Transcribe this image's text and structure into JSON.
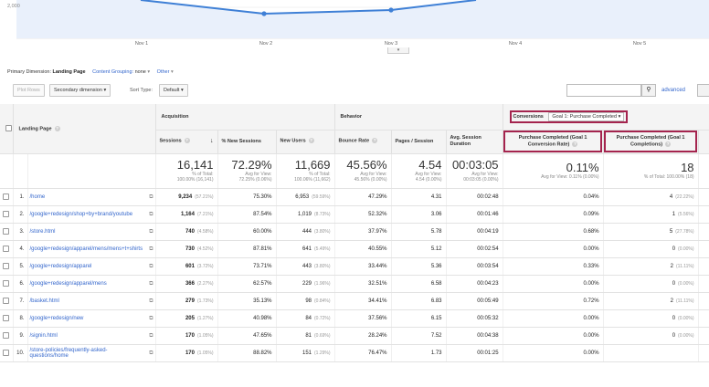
{
  "chart": {
    "y_tick": "2,000",
    "x_ticks": [
      "Nov 1",
      "Nov 2",
      "Nov 3",
      "Nov 4",
      "Nov 5"
    ]
  },
  "primary": {
    "label": "Primary Dimension:",
    "value": "Landing Page",
    "content_grouping": "Content Grouping:",
    "content_grouping_value": "none",
    "other": "Other"
  },
  "toolbar": {
    "plot_rows": "Plot Rows",
    "secondary_dimension": "Secondary dimension",
    "sort_type_label": "Sort Type:",
    "sort_type_value": "Default",
    "advanced": "advanced"
  },
  "headers": {
    "landing_page": "Landing Page",
    "acquisition": "Acquisition",
    "behavior": "Behavior",
    "conversions_label": "Conversions",
    "conversions_goal": "Goal 1: Purchase Completed",
    "sessions": "Sessions",
    "new_sessions": "% New Sessions",
    "new_users": "New Users",
    "bounce_rate": "Bounce Rate",
    "pages_session": "Pages / Session",
    "avg_duration": "Avg. Session Duration",
    "conv_rate": "Purchase Completed (Goal 1 Conversion Rate)",
    "completions": "Purchase Completed (Goal 1 Completions)"
  },
  "totals": {
    "sessions": {
      "big": "16,141",
      "s1": "% of Total:",
      "s2": "100.00% (16,141)"
    },
    "new_sessions": {
      "big": "72.29%",
      "s1": "Avg for View:",
      "s2": "72.25% (0.06%)"
    },
    "new_users": {
      "big": "11,669",
      "s1": "% of Total:",
      "s2": "100.06% (11,662)"
    },
    "bounce_rate": {
      "big": "45.56%",
      "s1": "Avg for View:",
      "s2": "45.56% (0.00%)"
    },
    "pages_session": {
      "big": "4.54",
      "s1": "Avg for View:",
      "s2": "4.54 (0.00%)"
    },
    "avg_duration": {
      "big": "00:03:05",
      "s1": "Avg for View:",
      "s2": "00:03:05 (0.00%)"
    },
    "conv_rate": {
      "big": "0.11%",
      "s1": "Avg for View: 0.11% (0.00%)"
    },
    "completions": {
      "big": "18",
      "s1": "% of Total: 100.00% (18)"
    }
  },
  "rows": [
    {
      "idx": "1.",
      "page": "/home",
      "sessions": "9,234",
      "sessions_pct": "(57.21%)",
      "new_sessions": "75.30%",
      "new_users": "6,953",
      "new_users_pct": "(59.59%)",
      "bounce": "47.29%",
      "pages": "4.31",
      "duration": "00:02:48",
      "conv": "0.04%",
      "comp": "4",
      "comp_pct": "(22.22%)"
    },
    {
      "idx": "2.",
      "page": "/google+redesign/shop+by+brand/youtube",
      "sessions": "1,164",
      "sessions_pct": "(7.21%)",
      "new_sessions": "87.54%",
      "new_users": "1,019",
      "new_users_pct": "(8.73%)",
      "bounce": "52.32%",
      "pages": "3.06",
      "duration": "00:01:46",
      "conv": "0.09%",
      "comp": "1",
      "comp_pct": "(5.56%)"
    },
    {
      "idx": "3.",
      "page": "/store.html",
      "sessions": "740",
      "sessions_pct": "(4.58%)",
      "new_sessions": "60.00%",
      "new_users": "444",
      "new_users_pct": "(3.80%)",
      "bounce": "37.97%",
      "pages": "5.78",
      "duration": "00:04:19",
      "conv": "0.68%",
      "comp": "5",
      "comp_pct": "(27.78%)"
    },
    {
      "idx": "4.",
      "page": "/google+redesign/apparel/mens/mens+t+shirts",
      "sessions": "730",
      "sessions_pct": "(4.52%)",
      "new_sessions": "87.81%",
      "new_users": "641",
      "new_users_pct": "(5.49%)",
      "bounce": "40.55%",
      "pages": "5.12",
      "duration": "00:02:54",
      "conv": "0.00%",
      "comp": "0",
      "comp_pct": "(0.00%)"
    },
    {
      "idx": "5.",
      "page": "/google+redesign/apparel",
      "sessions": "601",
      "sessions_pct": "(3.72%)",
      "new_sessions": "73.71%",
      "new_users": "443",
      "new_users_pct": "(3.80%)",
      "bounce": "33.44%",
      "pages": "5.36",
      "duration": "00:03:54",
      "conv": "0.33%",
      "comp": "2",
      "comp_pct": "(11.11%)"
    },
    {
      "idx": "6.",
      "page": "/google+redesign/apparel/mens",
      "sessions": "366",
      "sessions_pct": "(2.27%)",
      "new_sessions": "62.57%",
      "new_users": "229",
      "new_users_pct": "(1.96%)",
      "bounce": "32.51%",
      "pages": "6.58",
      "duration": "00:04:23",
      "conv": "0.00%",
      "comp": "0",
      "comp_pct": "(0.00%)"
    },
    {
      "idx": "7.",
      "page": "/basket.html",
      "sessions": "279",
      "sessions_pct": "(1.73%)",
      "new_sessions": "35.13%",
      "new_users": "98",
      "new_users_pct": "(0.84%)",
      "bounce": "34.41%",
      "pages": "6.83",
      "duration": "00:05:49",
      "conv": "0.72%",
      "comp": "2",
      "comp_pct": "(11.11%)"
    },
    {
      "idx": "8.",
      "page": "/google+redesign/new",
      "sessions": "205",
      "sessions_pct": "(1.27%)",
      "new_sessions": "40.98%",
      "new_users": "84",
      "new_users_pct": "(0.72%)",
      "bounce": "37.56%",
      "pages": "6.15",
      "duration": "00:05:32",
      "conv": "0.00%",
      "comp": "0",
      "comp_pct": "(0.00%)"
    },
    {
      "idx": "9.",
      "page": "/signin.html",
      "sessions": "170",
      "sessions_pct": "(1.05%)",
      "new_sessions": "47.65%",
      "new_users": "81",
      "new_users_pct": "(0.69%)",
      "bounce": "28.24%",
      "pages": "7.52",
      "duration": "00:04:38",
      "conv": "0.00%",
      "comp": "0",
      "comp_pct": "(0.00%)"
    },
    {
      "idx": "10.",
      "page": "/store-policies/frequently-asked-questions/home",
      "sessions": "170",
      "sessions_pct": "(1.05%)",
      "new_sessions": "88.82%",
      "new_users": "151",
      "new_users_pct": "(1.29%)",
      "bounce": "76.47%",
      "pages": "1.73",
      "duration": "00:01:25",
      "conv": "0.00%",
      "comp": "",
      "comp_pct": ""
    }
  ]
}
